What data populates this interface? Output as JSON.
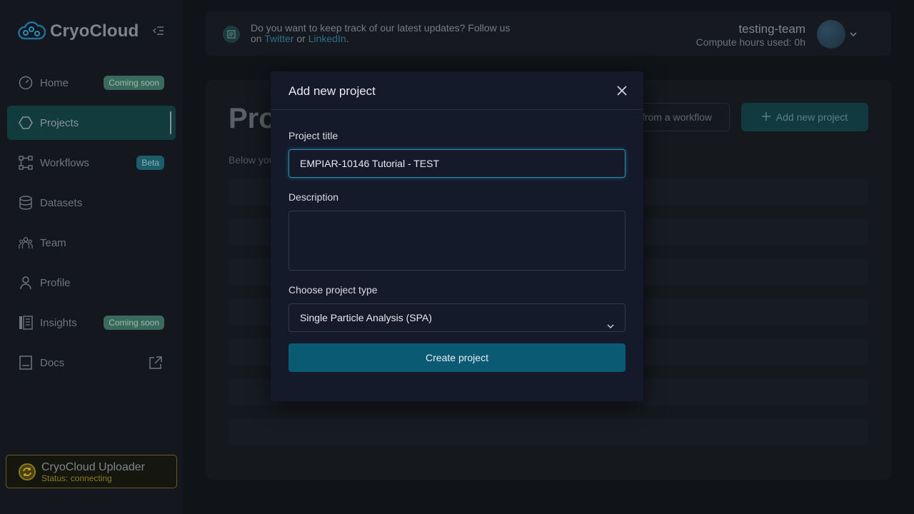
{
  "brand": {
    "name": "CryoCloud"
  },
  "sidebar": {
    "items": [
      {
        "label": "Home",
        "badge": "Coming soon",
        "icon": "gauge-icon"
      },
      {
        "label": "Projects",
        "active": true,
        "icon": "hexagon-icon"
      },
      {
        "label": "Workflows",
        "badge": "Beta",
        "icon": "workflow-icon"
      },
      {
        "label": "Datasets",
        "icon": "database-icon"
      },
      {
        "label": "Team",
        "icon": "team-icon"
      },
      {
        "label": "Profile",
        "icon": "user-icon"
      },
      {
        "label": "Insights",
        "badge": "Coming soon",
        "icon": "insights-icon"
      },
      {
        "label": "Docs",
        "icon": "book-icon",
        "external": true
      }
    ],
    "uploader": {
      "title": "CryoCloud Uploader",
      "status": "Status: connecting"
    }
  },
  "header": {
    "message_prefix": "Do you want to keep track of our latest updates? Follow us on ",
    "twitter": "Twitter",
    "or": " or ",
    "linkedin": "LinkedIn",
    "period": ".",
    "team": "testing-team",
    "compute": "Compute hours used: 0h"
  },
  "main": {
    "title": "Pro",
    "subtitle": "Below you",
    "from_workflow_label": "from a workflow",
    "add_project_label": "Add new project"
  },
  "modal": {
    "title": "Add new project",
    "project_title_label": "Project title",
    "project_title_value": "EMPIAR-10146 Tutorial - TEST",
    "description_label": "Description",
    "description_value": "",
    "project_type_label": "Choose project type",
    "project_type_value": "Single Particle Analysis (SPA)",
    "create_label": "Create project"
  },
  "colors": {
    "accent": "#0a5a74",
    "focus": "#2f8fb0",
    "uploader_warning": "#8a7a1f"
  }
}
